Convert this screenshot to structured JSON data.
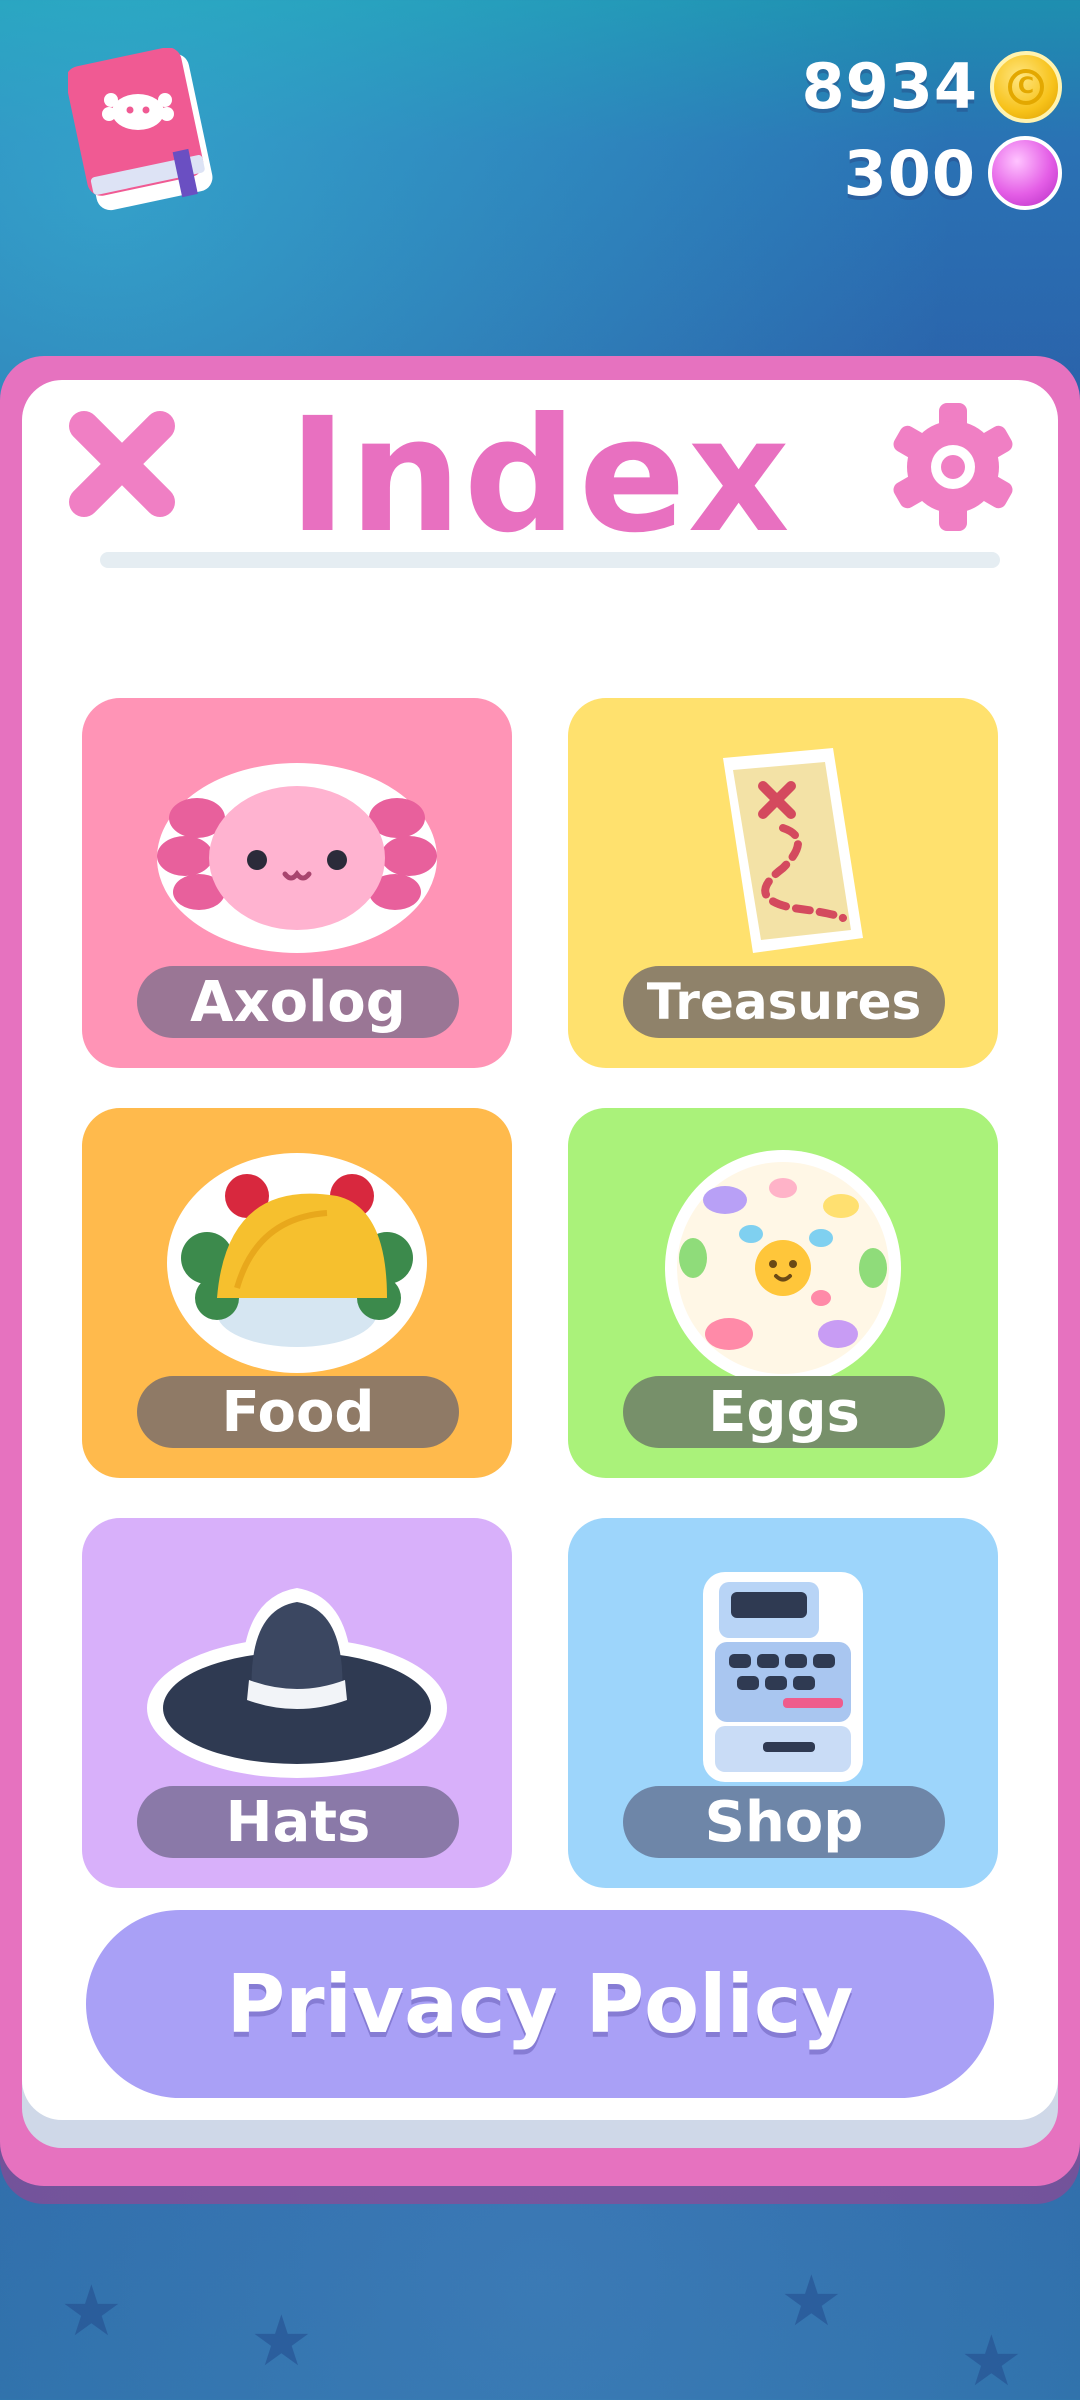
{
  "header": {
    "book_icon": "index-book-icon",
    "coins": {
      "value": "8934",
      "icon": "coin-icon",
      "coin_symbol": "C"
    },
    "gems": {
      "value": "300",
      "icon": "gem-icon"
    }
  },
  "panel": {
    "title": "Index",
    "close_icon": "close-icon",
    "settings_icon": "gear-icon",
    "colors": {
      "frame": "#e672bf",
      "title": "#e870c0"
    }
  },
  "cards": [
    {
      "label": "Axolog",
      "icon": "axolotl-icon",
      "bg": "#ff94b6",
      "pill": "#9a7695"
    },
    {
      "label": "Treasures",
      "icon": "treasure-map-icon",
      "bg": "#ffe16e",
      "pill": "#8f826a"
    },
    {
      "label": "Food",
      "icon": "taco-icon",
      "bg": "#ffba4c",
      "pill": "#8f7a66"
    },
    {
      "label": "Eggs",
      "icon": "egg-icon",
      "bg": "#aaf27a",
      "pill": "#77906a"
    },
    {
      "label": "Hats",
      "icon": "fedora-hat-icon",
      "bg": "#d8b0fa",
      "pill": "#8a79a8"
    },
    {
      "label": "Shop",
      "icon": "cash-register-icon",
      "bg": "#9dd5fb",
      "pill": "#6e86a8"
    }
  ],
  "privacy_button": {
    "label": "Privacy Policy",
    "color": "#a9a0f6"
  }
}
